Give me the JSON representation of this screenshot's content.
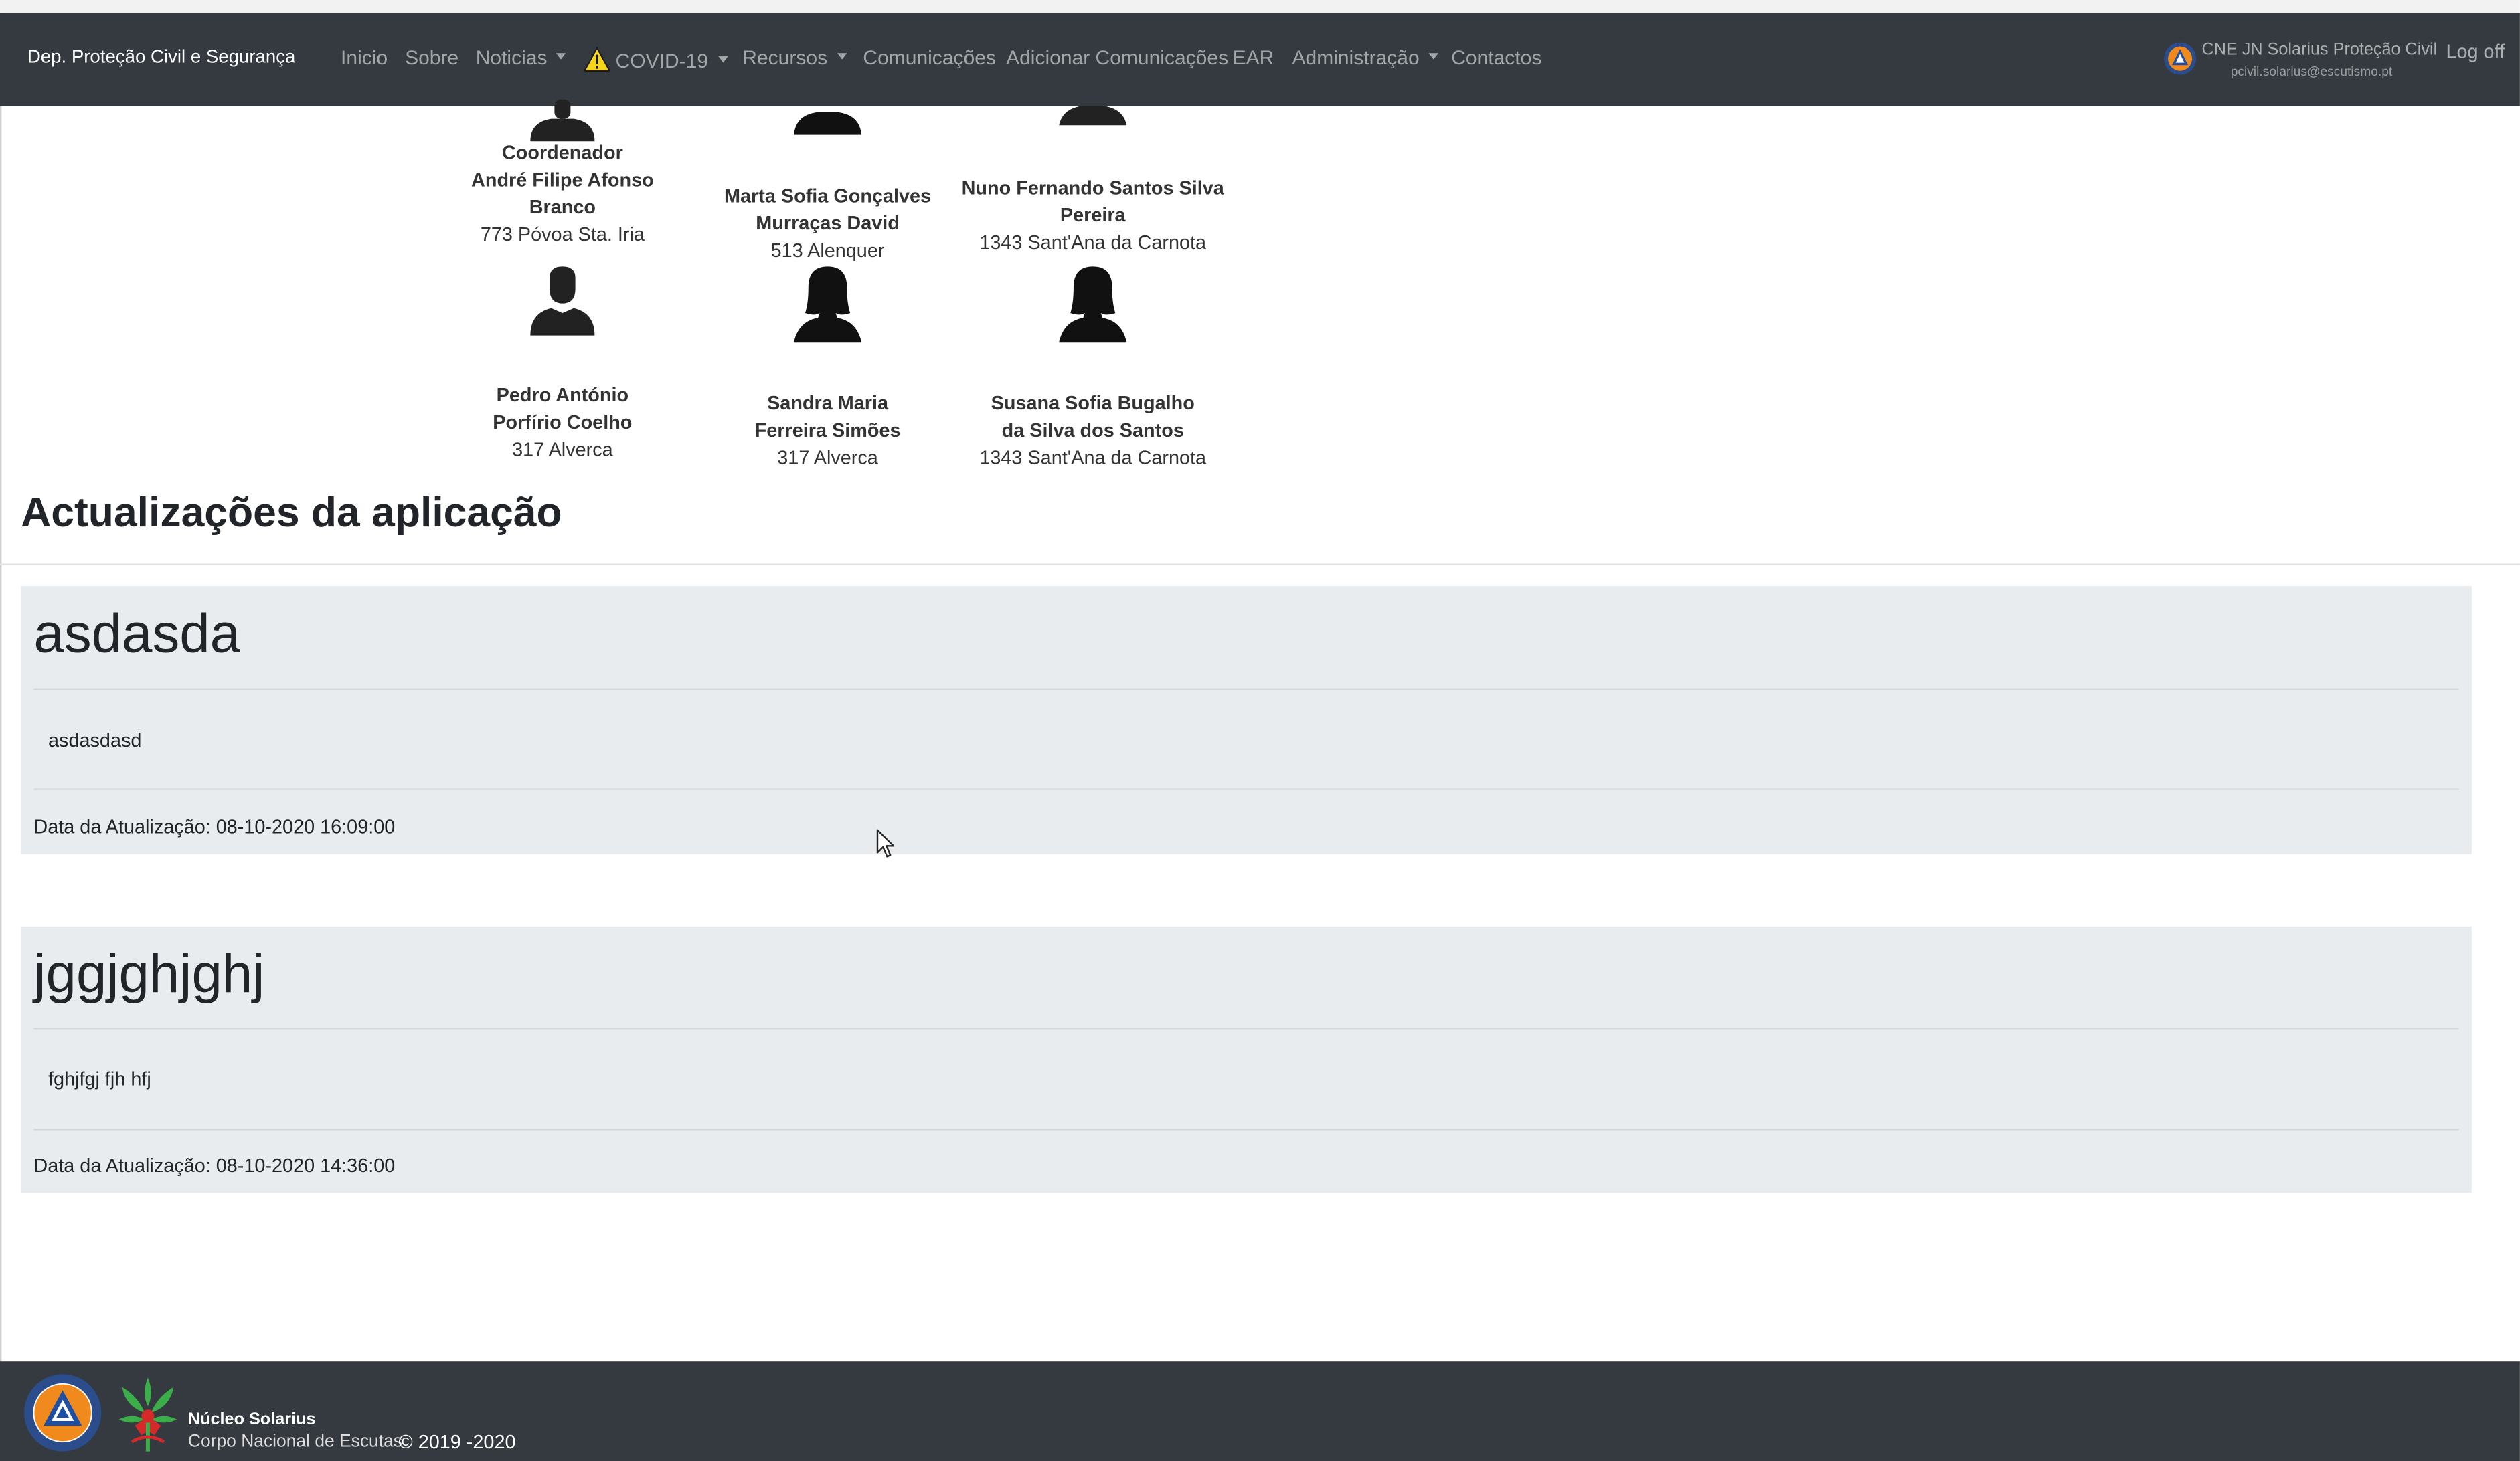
{
  "navbar": {
    "brand": "Dep. Proteção Civil e Segurança",
    "items": [
      {
        "label": "Inicio",
        "dropdown": false
      },
      {
        "label": "Sobre",
        "dropdown": false
      },
      {
        "label": "Noticias",
        "dropdown": true
      },
      {
        "label": "COVID-19",
        "dropdown": true,
        "icon": "warning-icon"
      },
      {
        "label": "Recursos",
        "dropdown": true
      },
      {
        "label": "Comunicações",
        "dropdown": false
      },
      {
        "label": "Adicionar Comunicações",
        "dropdown": false
      },
      {
        "label": "EAR",
        "dropdown": false
      },
      {
        "label": "Administração",
        "dropdown": true
      },
      {
        "label": "Contactos",
        "dropdown": false
      }
    ],
    "user_name": "CNE JN Solarius Proteção Civil",
    "user_email": "pcivil.solarius@escutismo.pt",
    "logoff": "Log off"
  },
  "team": [
    {
      "role": "Coordenador",
      "name_lines": [
        "André Filipe Afonso",
        "Branco"
      ],
      "location": "773 Póvoa Sta. Iria",
      "avatar": "male-avatar-icon"
    },
    {
      "role": "",
      "name_lines": [
        "Marta Sofia Gonçalves",
        "Murraças David"
      ],
      "location": "513 Alenquer",
      "avatar": "female-avatar-icon"
    },
    {
      "role": "",
      "name_lines": [
        "Nuno Fernando Santos Silva",
        "Pereira"
      ],
      "location": "1343 Sant'Ana da Carnota",
      "avatar": "male-avatar-icon"
    },
    {
      "role": "",
      "name_lines": [
        "Pedro António",
        "Porfírio Coelho"
      ],
      "location": "317 Alverca",
      "avatar": "male-avatar-icon"
    },
    {
      "role": "",
      "name_lines": [
        "Sandra Maria",
        "Ferreira Simões"
      ],
      "location": "317 Alverca",
      "avatar": "female-avatar-icon"
    },
    {
      "role": "",
      "name_lines": [
        "Susana Sofia Bugalho",
        "da Silva dos Santos"
      ],
      "location": "1343 Sant'Ana da Carnota",
      "avatar": "female-avatar-icon"
    }
  ],
  "updates_section": {
    "title": "Actualizações da aplicação",
    "updates": [
      {
        "title": "asdasda",
        "body": "asdasdasd",
        "date": "Data da Atualização: 08-10-2020 16:09:00"
      },
      {
        "title": "jggjghjghj",
        "body": "fghjfgj fjh hfj",
        "date": "Data da Atualização: 08-10-2020 14:36:00"
      }
    ]
  },
  "footer": {
    "org_name": "Núcleo Solarius",
    "org_sub": "Corpo Nacional de Escutas",
    "copyright": "© 2019 -2020"
  },
  "colors": {
    "navbar_bg": "#343a40",
    "update_bg": "#e9ecef",
    "warning_yellow": "#f7d619"
  }
}
